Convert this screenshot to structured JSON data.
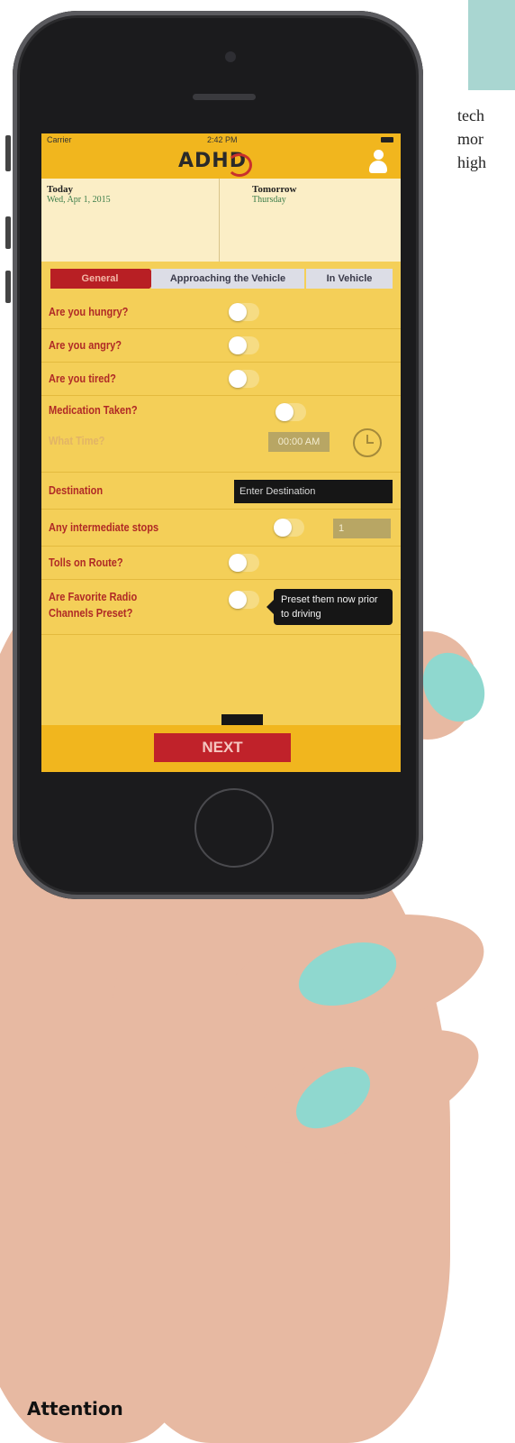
{
  "page": {
    "side_text_lines": [
      "tech",
      "mor",
      "high"
    ],
    "caption": "Attention"
  },
  "status_bar": {
    "carrier": "Carrier",
    "time": "2:42 PM"
  },
  "app": {
    "logo_text": "ADHD",
    "today": {
      "label": "Today",
      "date": "Wed, Apr 1, 2015"
    },
    "tomorrow": {
      "label": "Tomorrow",
      "day": "Thursday"
    },
    "tabs": [
      "General",
      "Approaching the Vehicle",
      "In Vehicle"
    ],
    "questions": {
      "hungry": "Are you hungry?",
      "angry": "Are you angry?",
      "tired": "Are you tired?",
      "medication": "Medication Taken?",
      "what_time": "What Time?",
      "destination": "Destination",
      "stops": "Any intermediate stops",
      "tolls": "Tolls on Route?",
      "radio": "Are Favorite Radio Channels Preset?"
    },
    "time_value": "00:00 AM",
    "destination_placeholder": "Enter Destination",
    "stops_value": "1",
    "preset_button": "Preset them now prior to driving",
    "next_button": "NEXT"
  }
}
